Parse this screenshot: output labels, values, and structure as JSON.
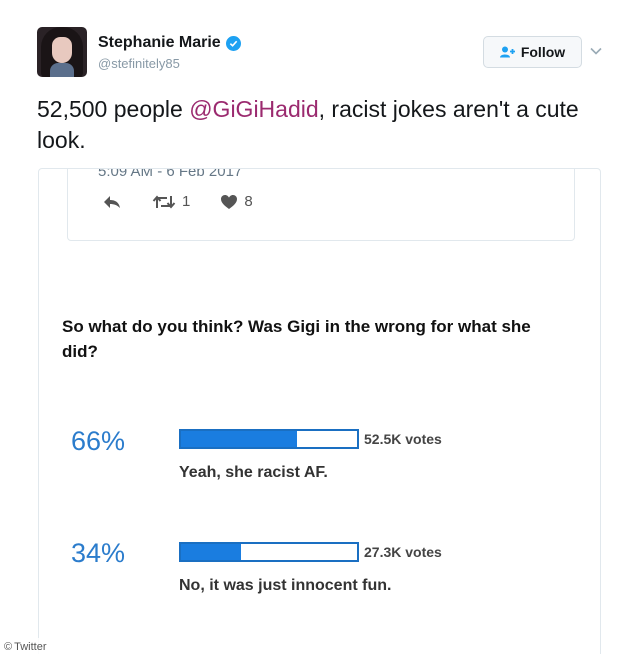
{
  "tweet": {
    "display_name": "Stephanie Marie",
    "handle": "@stefinitely85",
    "follow_label": "Follow",
    "text_before": "52,500 people ",
    "mention": "@GiGiHadid",
    "text_after": ", racist jokes aren't a cute look."
  },
  "quoted_tweet": {
    "timestamp": "5:09 AM - 6 Feb 2017",
    "retweets": "1",
    "likes": "8"
  },
  "poll": {
    "question": "So what do you think? Was Gigi in the wrong for what she did?",
    "options": [
      {
        "percent": "66%",
        "fill": 0.66,
        "votes": "52.5K votes",
        "label": "Yeah, she racist AF."
      },
      {
        "percent": "34%",
        "fill": 0.34,
        "votes": "27.3K votes",
        "label": "No, it was just innocent fun."
      }
    ]
  },
  "colors": {
    "accent": "#1da1f2",
    "mention": "#9b2a6f",
    "poll_bar": "#1a7de0",
    "poll_percent": "#2b7ccc"
  },
  "credit": "Twitter"
}
